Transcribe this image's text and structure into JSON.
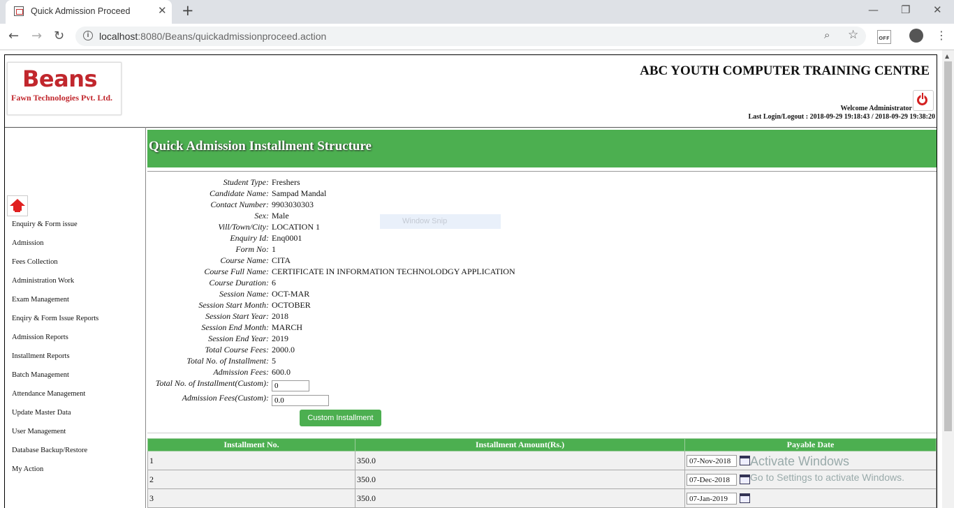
{
  "browser": {
    "tab_title": "Quick Admission Proceed",
    "url_host": "localhost",
    "url_path": ":8080/Beans/quickadmissionproceed.action",
    "ext_label": "OFF"
  },
  "header": {
    "logo_big": "Beans",
    "logo_small": "Fawn Technologies Pvt. Ltd.",
    "org_title": "ABC YOUTH COMPUTER TRAINING CENTRE",
    "welcome": "Welcome Administrator",
    "last_login": "Last Login/Logout : 2018-09-29 19:18:43 / 2018-09-29 19:38:20"
  },
  "sidebar": {
    "items": [
      "Enquiry & Form issue",
      "Admission",
      "Fees Collection",
      "Administration Work",
      "Exam Management",
      "Enqiry & Form Issue Reports",
      "Admission Reports",
      "Installment Reports",
      "Batch Management",
      "Attendance Management",
      "Update Master Data",
      "User Management",
      "Database Backup/Restore",
      "My Action"
    ]
  },
  "main": {
    "title": "Quick Admission Installment Structure",
    "fields": [
      {
        "label": "Student Type:",
        "value": "Freshers"
      },
      {
        "label": "Candidate Name:",
        "value": "Sampad Mandal"
      },
      {
        "label": "Contact Number:",
        "value": "9903030303"
      },
      {
        "label": "Sex:",
        "value": "Male"
      },
      {
        "label": "Vill/Town/City:",
        "value": "LOCATION 1"
      },
      {
        "label": "Enquiry Id:",
        "value": "Enq0001"
      },
      {
        "label": "Form No:",
        "value": "1"
      },
      {
        "label": "Course Name:",
        "value": "CITA"
      },
      {
        "label": "Course Full Name:",
        "value": "CERTIFICATE IN INFORMATION TECHNOLODGY APPLICATION"
      },
      {
        "label": "Course Duration:",
        "value": "6"
      },
      {
        "label": "Session Name:",
        "value": "OCT-MAR"
      },
      {
        "label": "Session Start Month:",
        "value": "OCTOBER"
      },
      {
        "label": "Session Start Year:",
        "value": "2018"
      },
      {
        "label": "Session End Month:",
        "value": "MARCH"
      },
      {
        "label": "Session End Year:",
        "value": "2019"
      },
      {
        "label": "Total Course Fees:",
        "value": "2000.0"
      },
      {
        "label": "Total No. of Installment:",
        "value": "5"
      },
      {
        "label": "Admission Fees:",
        "value": "600.0"
      }
    ],
    "custom_installment_label": "Total No. of Installment(Custom):",
    "custom_installment_value": "0",
    "custom_fees_label": "Admission Fees(Custom):",
    "custom_fees_value": "0.0",
    "custom_button": "Custom Installment",
    "table": {
      "headers": [
        "Installment No.",
        "Installment Amount(Rs.)",
        "Payable Date"
      ],
      "rows": [
        {
          "no": "1",
          "amount": "350.0",
          "date": "07-Nov-2018"
        },
        {
          "no": "2",
          "amount": "350.0",
          "date": "07-Dec-2018"
        },
        {
          "no": "3",
          "amount": "350.0",
          "date": "07-Jan-2019"
        }
      ]
    }
  },
  "overlay": {
    "snip_text": "Window Snip",
    "activate_title": "Activate Windows",
    "activate_sub": "Go to Settings to activate Windows."
  }
}
